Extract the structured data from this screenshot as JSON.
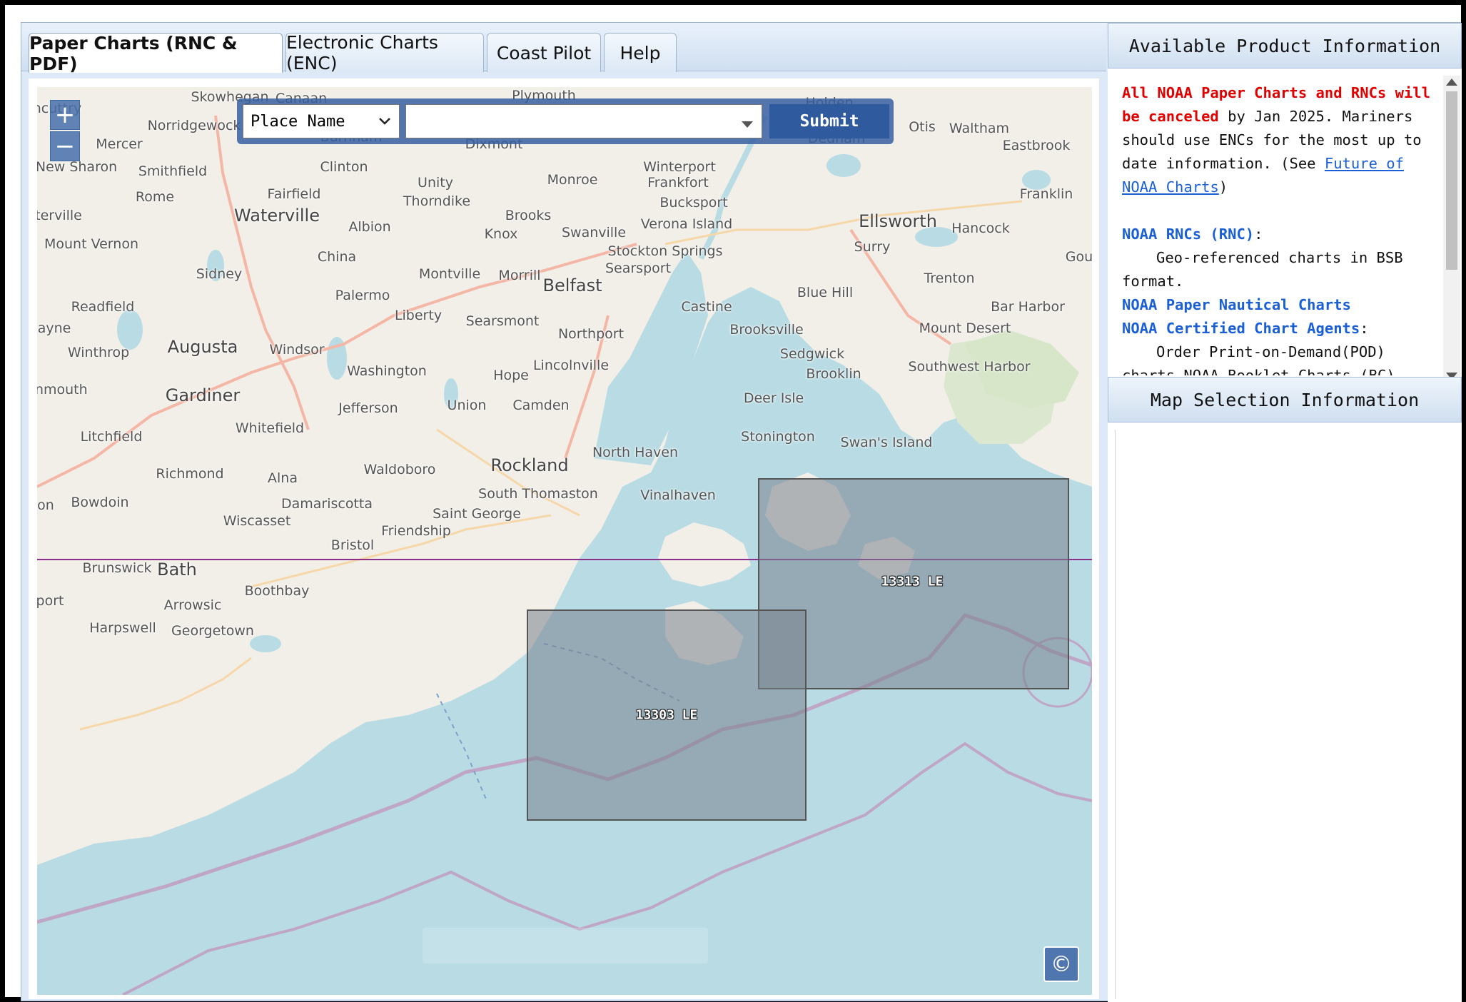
{
  "tabs": [
    {
      "label": "Paper Charts (RNC & PDF)",
      "active": true
    },
    {
      "label": "Electronic Charts (ENC)",
      "active": false
    },
    {
      "label": "Coast Pilot",
      "active": false
    },
    {
      "label": "Help",
      "active": false
    }
  ],
  "search": {
    "type_selected": "Place Name",
    "value": "",
    "submit_label": "Submit"
  },
  "zoom": {
    "in_label": "+",
    "out_label": "−"
  },
  "map": {
    "attribution_icon": "©",
    "places": [
      {
        "name": "Skowhegan"
      },
      {
        "name": "Canaan"
      },
      {
        "name": "Plymouth"
      },
      {
        "name": "Holden"
      },
      {
        "name": "Norridgewock"
      },
      {
        "name": "Burnham"
      },
      {
        "name": "Dixmont"
      },
      {
        "name": "Dedham"
      },
      {
        "name": "Otis"
      },
      {
        "name": "Waltham"
      },
      {
        "name": "Eastbrook"
      },
      {
        "name": "Mercer"
      },
      {
        "name": "New Sharon"
      },
      {
        "name": "Smithfield"
      },
      {
        "name": "Clinton"
      },
      {
        "name": "Unity"
      },
      {
        "name": "Monroe"
      },
      {
        "name": "Winterport"
      },
      {
        "name": "Frankfort"
      },
      {
        "name": "Rome"
      },
      {
        "name": "Fairfield"
      },
      {
        "name": "Thorndike"
      },
      {
        "name": "Bucksport"
      },
      {
        "name": "Franklin"
      },
      {
        "name": "terville"
      },
      {
        "name": "Waterville"
      },
      {
        "name": "Brooks"
      },
      {
        "name": "Albion"
      },
      {
        "name": "Swanville"
      },
      {
        "name": "Verona Island"
      },
      {
        "name": "Ellsworth"
      },
      {
        "name": "Hancock"
      },
      {
        "name": "Knox"
      },
      {
        "name": "Mount Vernon"
      },
      {
        "name": "Stockton Springs"
      },
      {
        "name": "Surry"
      },
      {
        "name": "China"
      },
      {
        "name": "Searsport"
      },
      {
        "name": "Gou"
      },
      {
        "name": "Sidney"
      },
      {
        "name": "Montville"
      },
      {
        "name": "Morrill"
      },
      {
        "name": "Trenton"
      },
      {
        "name": "Belfast"
      },
      {
        "name": "Blue Hill"
      },
      {
        "name": "Palermo"
      },
      {
        "name": "Readfield"
      },
      {
        "name": "Castine"
      },
      {
        "name": "Bar Harbor"
      },
      {
        "name": "Liberty"
      },
      {
        "name": "Searsmont"
      },
      {
        "name": "Brooksville"
      },
      {
        "name": "Mount Desert"
      },
      {
        "name": "ayne"
      },
      {
        "name": "Northport"
      },
      {
        "name": "Augusta"
      },
      {
        "name": "Winthrop"
      },
      {
        "name": "Windsor"
      },
      {
        "name": "Sedgwick"
      },
      {
        "name": "Lincolnville"
      },
      {
        "name": "Southwest Harbor"
      },
      {
        "name": "Washington"
      },
      {
        "name": "Hope"
      },
      {
        "name": "Brooklin"
      },
      {
        "name": "onmouth"
      },
      {
        "name": "Gardiner"
      },
      {
        "name": "Jefferson"
      },
      {
        "name": "Union"
      },
      {
        "name": "Camden"
      },
      {
        "name": "Deer Isle"
      },
      {
        "name": "Whitefield"
      },
      {
        "name": "Litchfield"
      },
      {
        "name": "Stonington"
      },
      {
        "name": "Swan's Island"
      },
      {
        "name": "North Haven"
      },
      {
        "name": "Rockland"
      },
      {
        "name": "Waldoboro"
      },
      {
        "name": "Richmond"
      },
      {
        "name": "Alna"
      },
      {
        "name": "South Thomaston"
      },
      {
        "name": "Vinalhaven"
      },
      {
        "name": "Bowdoin"
      },
      {
        "name": "Damariscotta"
      },
      {
        "name": "on"
      },
      {
        "name": "Saint George"
      },
      {
        "name": "Wiscasset"
      },
      {
        "name": "Friendship"
      },
      {
        "name": "Bristol"
      },
      {
        "name": "Brunswick"
      },
      {
        "name": "Bath"
      },
      {
        "name": "Boothbay"
      },
      {
        "name": "Arrowsic"
      },
      {
        "name": "port"
      },
      {
        "name": "Harpswell"
      },
      {
        "name": "Georgetown"
      },
      {
        "name": "ncuttry"
      }
    ],
    "charts": [
      {
        "label": "13313 LE"
      },
      {
        "label": "13303 LE"
      }
    ]
  },
  "right_panel": {
    "available_title": "Available Product Information",
    "notice_red": "All NOAA Paper Charts and RNCs will be canceled",
    "notice_rest": " by Jan 2025. Mariners should use ENCs for the most up to date information. (See ",
    "notice_link": "Future of NOAA Charts",
    "notice_close": ")",
    "rnc_title": "NOAA RNCs (RNC)",
    "rnc_colon": ":",
    "rnc_desc": "Geo-referenced charts in BSB format.",
    "paper_title": "NOAA Paper Nautical Charts",
    "agents_title": "NOAA Certified Chart Agents",
    "agents_colon": ":",
    "agents_desc": "Order Print-on-Demand(POD)",
    "partial_line": "charts NOAA Booklet Charts (BC)",
    "selection_title": "Map Selection Information"
  },
  "colors": {
    "water": "#b8dbe4",
    "land": "#f2efe9",
    "chart_fill": "#7f8a93",
    "accent": "#2f5b9e",
    "alert": "#e00000",
    "link": "#1a5fd6"
  }
}
